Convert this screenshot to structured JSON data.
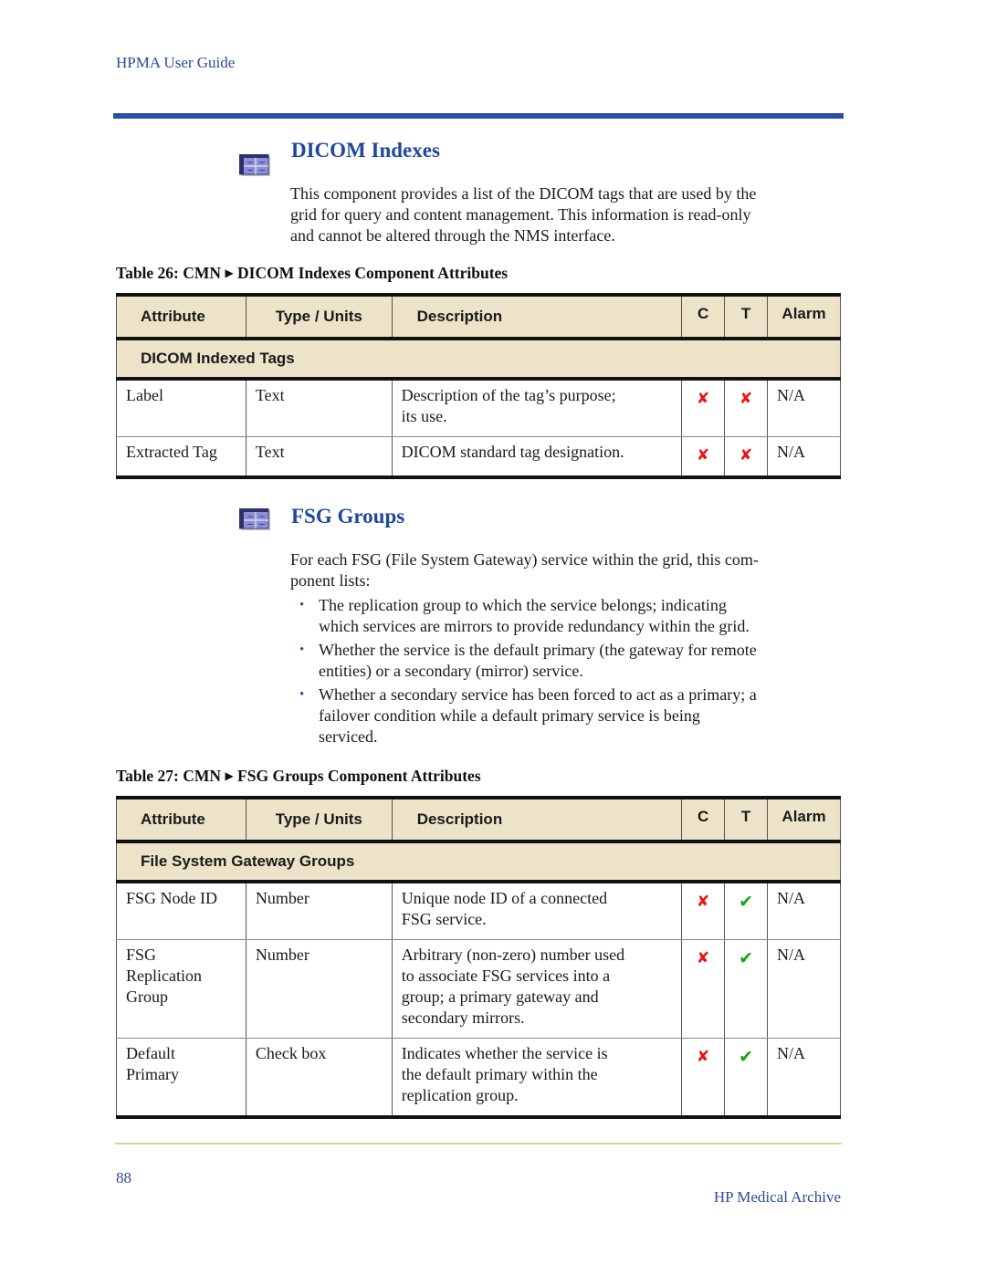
{
  "header": {
    "running_title": "HPMA User Guide"
  },
  "sections": [
    {
      "icon": "table-component-icon",
      "title": "DICOM Indexes",
      "intro": "This component provides a list of the DICOM tags that are used by the grid for query and content management. This information is read-only and cannot be altered through the NMS interface.",
      "intro_lines": [
        "This component provides a list of the DICOM tags that are used by the",
        "grid for query and content management. This information is read-only",
        "and cannot be altered through the NMS interface."
      ]
    },
    {
      "icon": "table-component-icon",
      "title": "FSG Groups",
      "intro_lines": [
        "For each FSG (File System Gateway) service within the grid, this com-",
        "ponent lists:"
      ],
      "bullets": [
        {
          "bullet": "•",
          "lines": [
            "The replication group to which the service belongs; indicating",
            "which services are mirrors to provide redundancy within the grid."
          ]
        },
        {
          "bullet": "•",
          "lines": [
            "Whether the service is the default primary (the gateway for remote",
            "entities) or a secondary (mirror) service."
          ]
        },
        {
          "bullet": "•",
          "lines": [
            "Whether a secondary service has been forced to act as a primary; a",
            "failover condition while a default primary service is being",
            "serviced."
          ]
        }
      ]
    }
  ],
  "tables": [
    {
      "caption_prefix": "Table 26: CMN",
      "caption_arrow": "▶",
      "caption_suffix": "DICOM Indexes Component Attributes",
      "columns": [
        "Attribute",
        "Type / Units",
        "Description",
        "C",
        "T",
        "Alarm"
      ],
      "group": "DICOM Indexed Tags",
      "rows": [
        {
          "attribute_lines": [
            "Label"
          ],
          "type": "Text",
          "description_lines": [
            "Description of the tag’s purpose;",
            "its use."
          ],
          "c": "✘",
          "c_state": "no",
          "t": "✘",
          "t_state": "no",
          "alarm": "N/A"
        },
        {
          "attribute_lines": [
            "Extracted Tag"
          ],
          "type": "Text",
          "description_lines": [
            "DICOM standard tag designation."
          ],
          "c": "✘",
          "c_state": "no",
          "t": "✘",
          "t_state": "no",
          "alarm": "N/A"
        }
      ]
    },
    {
      "caption_prefix": "Table 27: CMN",
      "caption_arrow": "▶",
      "caption_suffix": "FSG Groups Component Attributes",
      "columns": [
        "Attribute",
        "Type / Units",
        "Description",
        "C",
        "T",
        "Alarm"
      ],
      "group": "File System Gateway Groups",
      "rows": [
        {
          "attribute_lines": [
            "FSG Node ID"
          ],
          "type": "Number",
          "description_lines": [
            "Unique node ID of a connected",
            "FSG service."
          ],
          "c": "✘",
          "c_state": "no",
          "t": "✔",
          "t_state": "yes",
          "alarm": "N/A"
        },
        {
          "attribute_lines": [
            "FSG",
            "Replication",
            "Group"
          ],
          "type": "Number",
          "description_lines": [
            "Arbitrary (non-zero) number used",
            "to associate FSG services into a",
            "group; a primary gateway and",
            "secondary mirrors."
          ],
          "c": "✘",
          "c_state": "no",
          "t": "✔",
          "t_state": "yes",
          "alarm": "N/A"
        },
        {
          "attribute_lines": [
            "Default",
            "Primary"
          ],
          "type": "Check box",
          "description_lines": [
            "Indicates whether the service is",
            "the default primary within the",
            "replication group."
          ],
          "c": "✘",
          "c_state": "no",
          "t": "✔",
          "t_state": "yes",
          "alarm": "N/A"
        }
      ]
    }
  ],
  "colors": {
    "heading_blue": "#1f47a0",
    "rule_blue": "#2a4ea6",
    "table_header_bg": "#ece3c9",
    "no_mark": "#ee1111",
    "yes_mark": "#14a614",
    "footer_rule": "#e0cd96"
  },
  "footer": {
    "page_number": "88",
    "title": "HP Medical Archive"
  }
}
